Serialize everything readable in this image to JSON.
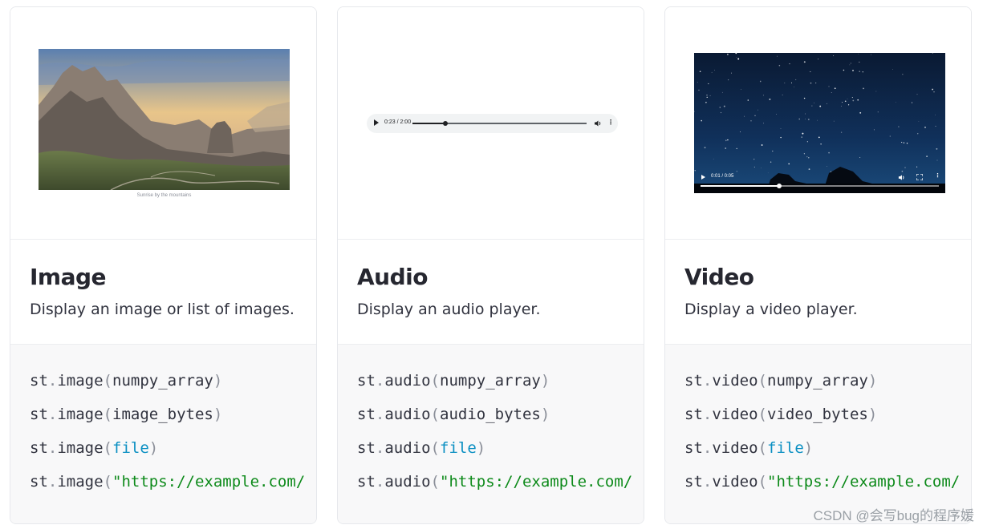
{
  "cards": [
    {
      "title": "Image",
      "description": "Display an image or list of images.",
      "preview": {
        "caption": "Sunrise by the mountains"
      },
      "code": [
        {
          "fn": "st",
          "method": "image",
          "arg": "numpy_array"
        },
        {
          "fn": "st",
          "method": "image",
          "arg": "image_bytes"
        },
        {
          "fn": "st",
          "method": "image",
          "arg": "file"
        },
        {
          "fn": "st",
          "method": "image",
          "arg": "\"https://example.com/"
        }
      ]
    },
    {
      "title": "Audio",
      "description": "Display an audio player.",
      "preview": {
        "time": "0:23 / 2:00",
        "progress": 0.19
      },
      "code": [
        {
          "fn": "st",
          "method": "audio",
          "arg": "numpy_array"
        },
        {
          "fn": "st",
          "method": "audio",
          "arg": "audio_bytes"
        },
        {
          "fn": "st",
          "method": "audio",
          "arg": "file"
        },
        {
          "fn": "st",
          "method": "audio",
          "arg": "\"https://example.com/"
        }
      ]
    },
    {
      "title": "Video",
      "description": "Display a video player.",
      "preview": {
        "time": "0:01 / 0:05",
        "progress": 0.33
      },
      "code": [
        {
          "fn": "st",
          "method": "video",
          "arg": "numpy_array"
        },
        {
          "fn": "st",
          "method": "video",
          "arg": "video_bytes"
        },
        {
          "fn": "st",
          "method": "video",
          "arg": "file"
        },
        {
          "fn": "st",
          "method": "video",
          "arg": "\"https://example.com/"
        }
      ]
    }
  ],
  "punctuation": {
    "dot": ".",
    "open": "(",
    "close": ")"
  },
  "watermark": "CSDN @会写bug的程序媛",
  "colors": {
    "keyword": "#0a8fc2",
    "string": "#0d8a1a",
    "punctuation": "#8b8f99",
    "text": "#31333f"
  }
}
